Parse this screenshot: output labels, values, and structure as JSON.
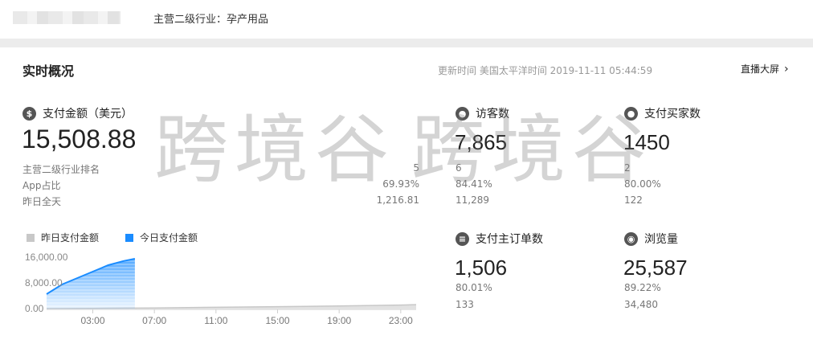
{
  "header": {
    "industry": "主营二级行业：孕产用品"
  },
  "section": {
    "title": "实时概况",
    "update_time": "更新时间 美国太平洋时间 2019-11-11 05:44:59",
    "big_screen": "直播大屏"
  },
  "payment": {
    "label": "支付金额（美元）",
    "value": "15,508.88",
    "rows": [
      {
        "label": "主营二级行业排名",
        "value": "5"
      },
      {
        "label": "App占比",
        "value": "69.93%"
      },
      {
        "label": "昨日全天",
        "value": "1,216.81"
      }
    ]
  },
  "visitors": {
    "label": "访客数",
    "value": "7,865",
    "rank": "6",
    "app_ratio": "84.41%",
    "yesterday": "11,289"
  },
  "buyers": {
    "label": "支付买家数",
    "value": "1450",
    "rank": "2",
    "app_ratio": "80.00%",
    "yesterday": "122"
  },
  "orders": {
    "label": "支付主订单数",
    "value": "1,506",
    "app_ratio": "80.01%",
    "yesterday": "133"
  },
  "pageviews": {
    "label": "浏览量",
    "value": "25,587",
    "app_ratio": "89.22%",
    "yesterday": "34,480"
  },
  "watermark": {
    "left": "跨境谷",
    "right": "跨境谷"
  },
  "chart_data": {
    "type": "area",
    "legend": [
      {
        "name": "昨日支付金额",
        "color": "#c8c8c8"
      },
      {
        "name": "今日支付金额",
        "color": "#1a8cff"
      }
    ],
    "y_ticks": [
      "16,000.00",
      "8,000.00",
      "0.00"
    ],
    "x_ticks": [
      "03:00",
      "07:00",
      "11:00",
      "15:00",
      "19:00",
      "23:00"
    ],
    "ylim": [
      0,
      16000
    ],
    "series": [
      {
        "name": "今日支付金额",
        "x": [
          "00:00",
          "01:00",
          "02:00",
          "03:00",
          "04:00",
          "05:00",
          "05:44"
        ],
        "values": [
          4500,
          7500,
          9500,
          11500,
          13500,
          14800,
          15508.88
        ]
      },
      {
        "name": "昨日支付金额",
        "x": [
          "00:00",
          "03:00",
          "07:00",
          "11:00",
          "15:00",
          "19:00",
          "23:00",
          "24:00"
        ],
        "values": [
          0,
          60,
          200,
          400,
          600,
          800,
          1100,
          1216.81
        ]
      }
    ]
  }
}
